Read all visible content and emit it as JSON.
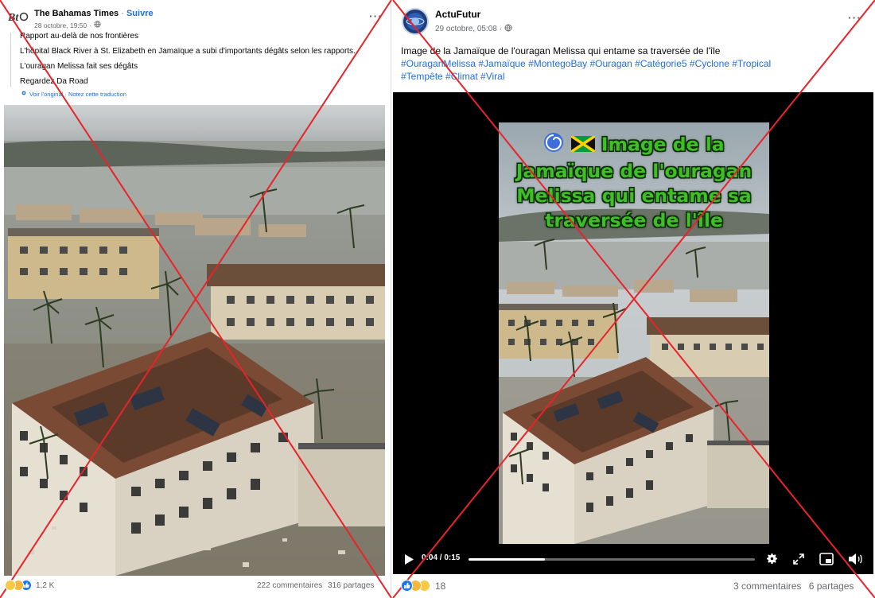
{
  "left_post": {
    "author": "The Bahamas Times",
    "separator": " · ",
    "follow": "Suivre",
    "date": "28 octobre, 19:50",
    "lines": [
      "Rapport au-delà de nos frontières",
      "L'hôpital Black River à St. Elizabeth en Jamaïque a subi d'importants dégâts selon les rapports.",
      "L'ouragan Melissa fait ses dégâts",
      "Regardez Da Road"
    ],
    "translation_links": "Voir l'original · Notez cette traduction",
    "reaction_count": "1,2 K",
    "comments": "222 commentaires",
    "shares": "316 partages",
    "avatar_text": "BT"
  },
  "right_post": {
    "author": "ActuFutur",
    "date": "29 octobre, 05:08",
    "text": "Image de la Jamaïque de l'ouragan Melissa qui entame sa traversée de l'île",
    "hashtags_line1": "#OuraganMelissa #Jamaïque #MontegoBay #Ouragan #Catégorie5 #Cyclone #Tropical",
    "hashtags_line2": "#Tempête #Climat #Viral",
    "video_title_line1": "Image de la",
    "video_title_line2": "Jamaïque de l'ouragan",
    "video_title_line3": "Melissa qui entame sa",
    "video_title_line4": "traversée de l'île",
    "video_time": "0:04 / 0:15",
    "video_progress": 0.267,
    "reaction_count": "18",
    "comments": "3 commentaires",
    "shares": "6 partages"
  },
  "colors": {
    "link_blue": "#216fdb",
    "cross_red": "#e8232a",
    "video_text_green": "#3fbf25"
  },
  "icons": [
    "globe-icon",
    "more-icon",
    "play-icon",
    "settings-icon",
    "expand-icon",
    "pip-icon",
    "volume-icon",
    "like-emoji",
    "haha-emoji",
    "wow-emoji",
    "sad-emoji"
  ]
}
